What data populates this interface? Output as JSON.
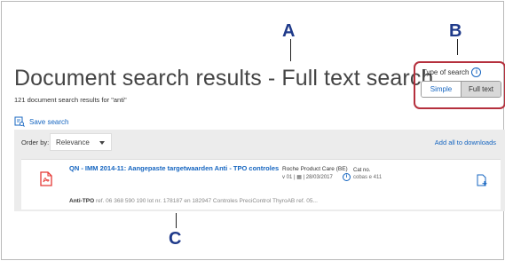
{
  "callouts": {
    "a": "A",
    "b": "B",
    "c": "C"
  },
  "page": {
    "title": "Document search results - Full text search",
    "result_count": "121 document search results for \"anti\""
  },
  "actions": {
    "save_search": "Save search",
    "add_all": "Add all to downloads"
  },
  "search_type": {
    "label": "Type of search",
    "options": [
      "Simple",
      "Full text"
    ],
    "selected": "Full text"
  },
  "order": {
    "label": "Order by:",
    "value": "Relevance"
  },
  "results": [
    {
      "title": "QN - IMM 2014-11: Aangepaste targetwaarden Anti - TPO controles",
      "organization": "Roche Product Care (BE)",
      "version": "v 01 | ▦ | 28/03/2017",
      "cat_label": "Cat no.",
      "cat_value": "cobas e 411",
      "snippet_highlight": "Anti-TPO",
      "snippet_rest": " ref. 06 368 590 190 lot nr. 178187 en 182947 Controles PreciControl ThyroAB ref. 05..."
    }
  ],
  "colors": {
    "accent": "#1565c0",
    "highlight_border": "#b5303d",
    "callout": "#1f3a8a",
    "panel": "#ececec",
    "pdf_icon": "#e53935"
  },
  "icons": {
    "save": "save-search-icon",
    "info": "info-icon",
    "pdf": "pdf-file-icon",
    "download": "add-download-icon",
    "dropdown": "chevron-down-icon"
  }
}
